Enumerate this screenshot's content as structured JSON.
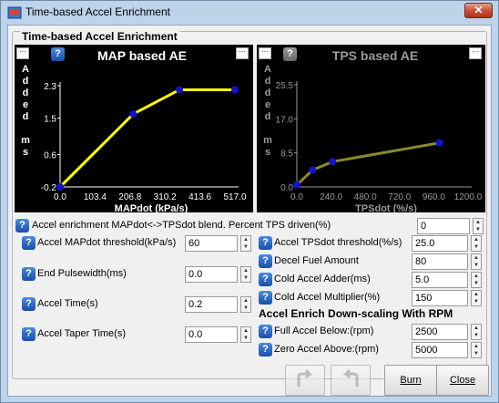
{
  "window": {
    "title": "Time-based Accel Enrichment",
    "close_label": "✕"
  },
  "group_title": "Time-based Accel Enrichment",
  "map_chart": {
    "title": "MAP based AE",
    "ylabel_chars": [
      "A",
      "d",
      "d",
      "e",
      "d",
      "",
      "m",
      "s"
    ],
    "xlabel": "MAPdot (kPa/s)",
    "yticks": [
      "2.3",
      "1.5",
      "0.6",
      "-0.2"
    ],
    "xticks": [
      "0.0",
      "103.4",
      "206.8",
      "310.2",
      "413.6",
      "517.0"
    ]
  },
  "tps_chart": {
    "title": "TPS based AE",
    "ylabel_chars": [
      "A",
      "d",
      "d",
      "e",
      "d",
      "",
      "m",
      "s"
    ],
    "xlabel": "TPSdot (%/s)",
    "yticks": [
      "25.5",
      "17.0",
      "8.5",
      "0.0"
    ],
    "xticks": [
      "0.0",
      "240.0",
      "480.0",
      "720.0",
      "960.0",
      "1200.0"
    ]
  },
  "chart_data": [
    {
      "type": "line",
      "title": "MAP based AE",
      "xlabel": "MAPdot (kPa/s)",
      "ylabel": "Added ms",
      "x": [
        0,
        216,
        353,
        517
      ],
      "y": [
        -0.2,
        1.6,
        2.2,
        2.2
      ],
      "xlim": [
        0,
        517
      ],
      "ylim": [
        -0.2,
        2.3
      ],
      "color": "#ffff00"
    },
    {
      "type": "line",
      "title": "TPS based AE",
      "xlabel": "TPSdot (%/s)",
      "ylabel": "Added ms",
      "x": [
        0,
        110,
        250,
        1000
      ],
      "y": [
        0.5,
        4.2,
        6.3,
        11.0
      ],
      "xlim": [
        0,
        1200
      ],
      "ylim": [
        0,
        25.5
      ],
      "color": "#8a8a2a"
    }
  ],
  "blend": {
    "label": "Accel enrichment MAPdot<->TPSdot blend. Percent TPS driven(%)",
    "value": "0"
  },
  "left_fields": [
    {
      "label": "Accel MAPdot threshold(kPa/s)",
      "value": "60"
    },
    {
      "label": "End Pulsewidth(ms)",
      "value": "0.0"
    },
    {
      "label": "Accel Time(s)",
      "value": "0.2"
    },
    {
      "label": "Accel Taper Time(s)",
      "value": "0.0"
    }
  ],
  "right_fields": [
    {
      "label": "Accel TPSdot threshold(%/s)",
      "value": "25.0"
    },
    {
      "label": "Decel Fuel Amount",
      "value": "80"
    },
    {
      "label": "Cold Accel Adder(ms)",
      "value": "5.0"
    },
    {
      "label": "Cold Accel Multiplier(%)",
      "value": "150"
    }
  ],
  "rpm_section": {
    "title": "Accel Enrich Down-scaling With RPM"
  },
  "rpm_fields": [
    {
      "label": "Full Accel Below:(rpm)",
      "value": "2500"
    },
    {
      "label": "Zero Accel Above:(rpm)",
      "value": "5000"
    }
  ],
  "buttons": {
    "burn": "Burn",
    "close": "Close"
  },
  "icons": {
    "help": "question-icon",
    "undo": "undo-icon",
    "redo": "redo-icon"
  }
}
